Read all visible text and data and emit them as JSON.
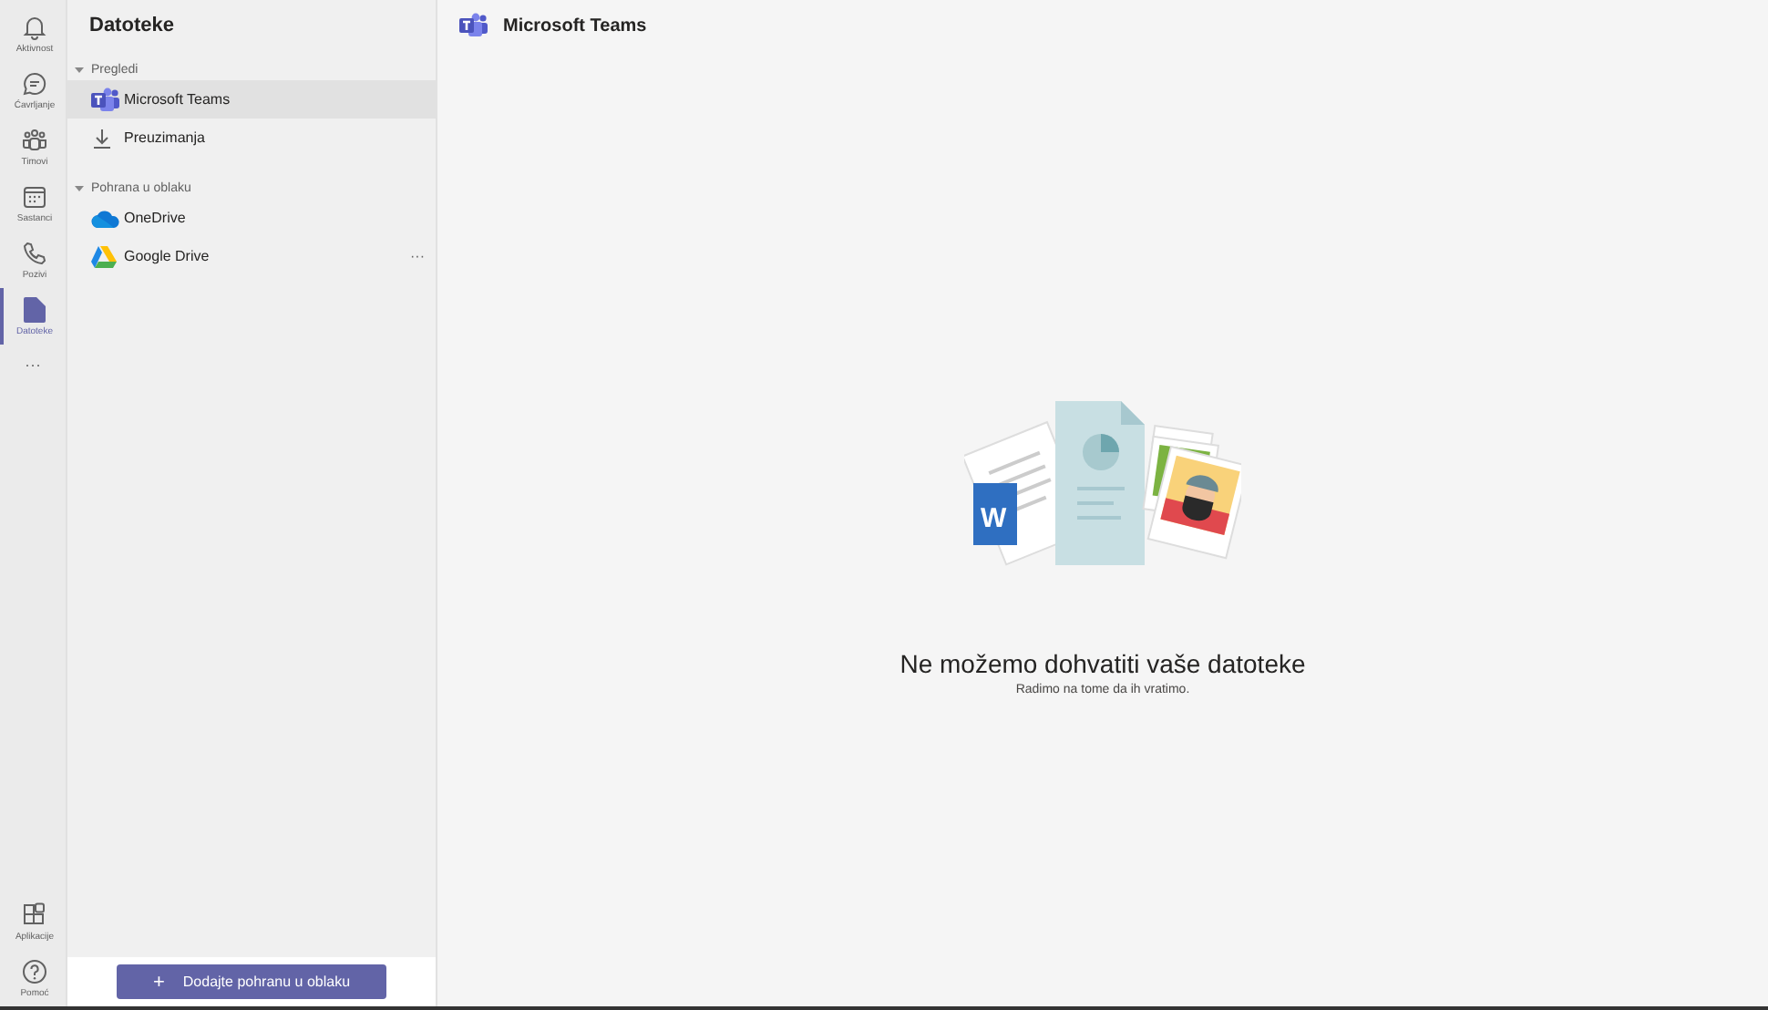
{
  "rail": {
    "top": [
      {
        "label": "Aktivnost",
        "kind": "bell",
        "selected": false
      },
      {
        "label": "Ćavrljanje",
        "kind": "chat",
        "selected": false
      },
      {
        "label": "Timovi",
        "kind": "people",
        "selected": false
      },
      {
        "label": "Sastanci",
        "kind": "calendar",
        "selected": false
      },
      {
        "label": "Pozivi",
        "kind": "phone",
        "selected": false
      },
      {
        "label": "Datoteke",
        "kind": "file",
        "selected": true
      }
    ],
    "more": "···",
    "bottom": [
      {
        "label": "Aplikacije",
        "kind": "apps",
        "selected": false
      },
      {
        "label": "Pomoć",
        "kind": "help",
        "selected": false
      }
    ]
  },
  "sidebar": {
    "title": "Datoteke",
    "sections": [
      {
        "label": "Pregledi",
        "expanded": true,
        "items": [
          {
            "label": "Microsoft Teams",
            "kind": "teams",
            "selected": true
          },
          {
            "label": "Preuzimanja",
            "kind": "download",
            "selected": false
          }
        ]
      },
      {
        "label": "Pohrana u oblaku",
        "expanded": true,
        "items": [
          {
            "label": "OneDrive",
            "kind": "onedrive",
            "selected": false
          },
          {
            "label": "Google Drive",
            "kind": "gdrive",
            "selected": false,
            "more": "···"
          }
        ]
      }
    ],
    "add_button": {
      "symbol": "+",
      "label": "Dodajte pohranu u oblaku"
    }
  },
  "main": {
    "title": "Microsoft Teams",
    "illustration_letter": "W",
    "empty_title": "Ne možemo dohvatiti vaše datoteke",
    "empty_subtitle": "Radimo na tome da ih vratimo."
  }
}
